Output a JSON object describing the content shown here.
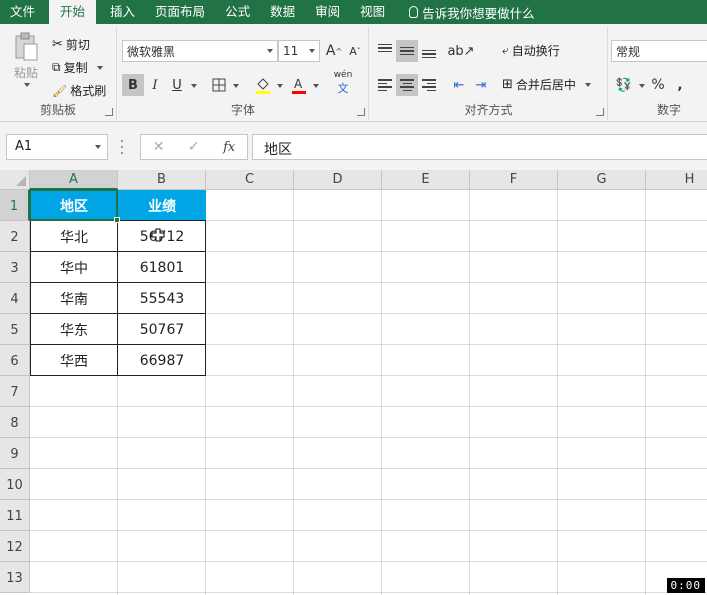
{
  "menu": {
    "tabs": [
      "文件",
      "开始",
      "插入",
      "页面布局",
      "公式",
      "数据",
      "审阅",
      "视图"
    ],
    "active_tab": "开始",
    "tell_me": "告诉我你想要做什么"
  },
  "ribbon": {
    "clipboard": {
      "label": "剪贴板",
      "paste": "粘贴",
      "cut": "剪切",
      "copy": "复制",
      "format_painter": "格式刷"
    },
    "font": {
      "label": "字体",
      "font_name": "微软雅黑",
      "font_size": "11",
      "grow": "A",
      "shrink": "A",
      "bold": "B",
      "italic": "I",
      "underline": "U",
      "phonetic": "wén"
    },
    "alignment": {
      "label": "对齐方式",
      "wrap_text": "自动换行",
      "merge_center": "合并后居中"
    },
    "number": {
      "label": "数字",
      "format": "常规",
      "percent": "%",
      "comma": ","
    }
  },
  "formula_bar": {
    "name_box": "A1",
    "fx": "fx",
    "content": "地区"
  },
  "sheet": {
    "columns": [
      "A",
      "B",
      "C",
      "D",
      "E",
      "F",
      "G",
      "H"
    ],
    "rows": [
      "1",
      "2",
      "3",
      "4",
      "5",
      "6",
      "7",
      "8",
      "9",
      "10",
      "11",
      "12",
      "13"
    ],
    "table": {
      "headers": [
        "地区",
        "业绩"
      ],
      "data": [
        [
          "华北",
          "56712"
        ],
        [
          "华中",
          "61801"
        ],
        [
          "华南",
          "55543"
        ],
        [
          "华东",
          "50767"
        ],
        [
          "华西",
          "66987"
        ]
      ]
    },
    "header_fill": "#00a5e5",
    "selected_cell": "A1"
  },
  "timer": "0:00"
}
